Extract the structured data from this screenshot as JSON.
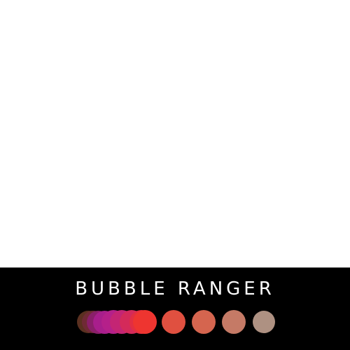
{
  "game": {
    "title": "BUBBLE RANGER"
  },
  "bubbles": [
    {
      "name": "bubble-1",
      "color": "#5a3020"
    },
    {
      "name": "bubble-2",
      "color": "#6f2a35"
    },
    {
      "name": "bubble-3",
      "color": "#8a1f6a"
    },
    {
      "name": "bubble-4",
      "color": "#a81e8c"
    },
    {
      "name": "bubble-5",
      "color": "#b5208a"
    },
    {
      "name": "bubble-6",
      "color": "#c42574"
    },
    {
      "name": "bubble-7",
      "color": "#d42a5a"
    },
    {
      "name": "bubble-8",
      "color": "#e22e42"
    },
    {
      "name": "bubble-9",
      "color": "#ee3530"
    },
    {
      "name": "bubble-10",
      "color": "#e05040"
    },
    {
      "name": "bubble-11",
      "color": "#d5654f"
    },
    {
      "name": "bubble-12",
      "color": "#c57a66"
    },
    {
      "name": "bubble-13",
      "color": "#ae9182"
    }
  ]
}
